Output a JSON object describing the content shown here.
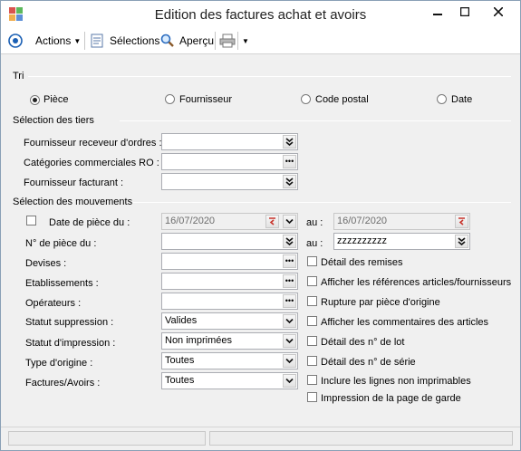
{
  "window": {
    "title": "Edition des factures achat et avoirs"
  },
  "toolbar": {
    "actions_label": "Actions",
    "selections_label": "Sélections",
    "apercu_label": "Aperçu"
  },
  "tri": {
    "title": "Tri",
    "options": [
      "Pièce",
      "Fournisseur",
      "Code postal",
      "Date"
    ],
    "selected": "Pièce"
  },
  "tiers": {
    "title": "Sélection des tiers",
    "rows": [
      {
        "label": "Fournisseur receveur d'ordres :",
        "value": "",
        "button": "dropdown"
      },
      {
        "label": "Catégories commerciales RO :",
        "value": "",
        "button": "ellipsis"
      },
      {
        "label": "Fournisseur facturant :",
        "value": "",
        "button": "dropdown"
      }
    ]
  },
  "mouvements": {
    "title": "Sélection des mouvements",
    "date_label": "Date de pièce du :",
    "date_from": "16/07/2020",
    "date_to_label": "au :",
    "date_to": "16/07/2020",
    "piece_label": "N° de pièce du :",
    "piece_from": "",
    "piece_to_label": "au :",
    "piece_to": "zzzzzzzzzz",
    "devises_label": "Devises :",
    "etablissements_label": "Etablissements :",
    "operateurs_label": "Opérateurs :",
    "statut_suppression_label": "Statut suppression :",
    "statut_suppression_value": "Valides",
    "statut_impression_label": "Statut d'impression :",
    "statut_impression_value": "Non imprimées",
    "type_origine_label": "Type d'origine :",
    "type_origine_value": "Toutes",
    "factures_avoirs_label": "Factures/Avoirs :",
    "factures_avoirs_value": "Toutes",
    "checks": [
      "Détail des remises",
      "Afficher les références articles/fournisseurs",
      "Rupture par pièce d'origine",
      "Afficher les commentaires des articles",
      "Détail des n° de lot",
      "Détail des n° de série",
      "Inclure les lignes non imprimables",
      "Impression de la page de garde"
    ]
  },
  "icons": {
    "dropdown": "double-chevron-down-icon",
    "ellipsis": "ellipsis-icon",
    "calendar": "calendar-icon",
    "actions": "target-icon",
    "selections": "document-icon",
    "apercu": "magnifier-icon",
    "print": "printer-icon"
  },
  "colors": {
    "accent": "#1a5fb4",
    "window_bg": "#f0f0f0",
    "field_border": "#abadb3",
    "calendar_red": "#c8322a"
  }
}
